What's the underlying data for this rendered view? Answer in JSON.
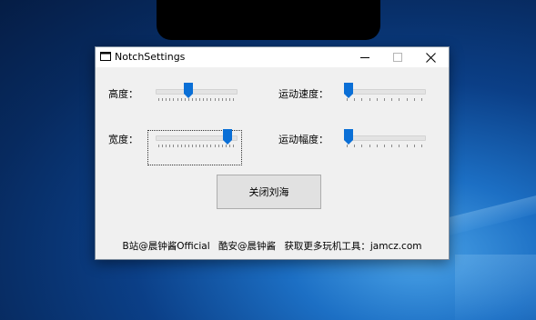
{
  "window": {
    "title": "NotchSettings",
    "minimize_glyph": "—",
    "maximize_glyph": "☐",
    "close_glyph": "✕"
  },
  "settings": {
    "height": {
      "label": "高度：",
      "value": 0.4
    },
    "speed": {
      "label": "运动速度：",
      "value": 0.0
    },
    "width": {
      "label": "宽度：",
      "value": 0.95
    },
    "amplitude": {
      "label": "运动幅度：",
      "value": 0.0
    }
  },
  "actions": {
    "close_notch": "关闭刘海"
  },
  "footer": {
    "bilibili": "B站@晨钟酱Official",
    "coolapk": "酷安@晨钟酱",
    "more_tools": "获取更多玩机工具：jamcz.com"
  },
  "colors": {
    "thumb": "#0a6fd6",
    "accent_bg": "#0b3f87"
  }
}
